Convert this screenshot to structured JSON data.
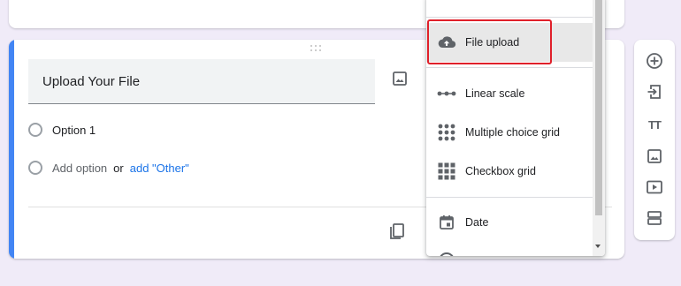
{
  "question": {
    "title": "Upload Your File",
    "options": [
      {
        "label": "Option 1"
      }
    ],
    "add_option_label": "Add option",
    "or_label": "or",
    "add_other_label": "add \"Other\""
  },
  "type_menu": {
    "items": [
      {
        "label": "File upload",
        "icon": "cloud-upload-icon",
        "selected": true
      },
      {
        "label": "Linear scale",
        "icon": "linear-scale-icon"
      },
      {
        "label": "Multiple choice grid",
        "icon": "multiple-choice-grid-icon"
      },
      {
        "label": "Checkbox grid",
        "icon": "checkbox-grid-icon"
      },
      {
        "label": "Date",
        "icon": "calendar-icon"
      }
    ],
    "highlight_color": "#e0202a"
  },
  "side_toolbar": {
    "tools": [
      {
        "name": "add-question",
        "icon": "add-circle-icon"
      },
      {
        "name": "import-questions",
        "icon": "import-icon"
      },
      {
        "name": "add-title-description",
        "icon": "title-icon",
        "glyph": "TT"
      },
      {
        "name": "add-image",
        "icon": "image-icon"
      },
      {
        "name": "add-video",
        "icon": "video-icon"
      },
      {
        "name": "add-section",
        "icon": "section-icon"
      }
    ]
  },
  "colors": {
    "background": "#f0ebf8",
    "accent": "#4285f4",
    "link": "#1a73e8",
    "icon": "#5f6368"
  }
}
